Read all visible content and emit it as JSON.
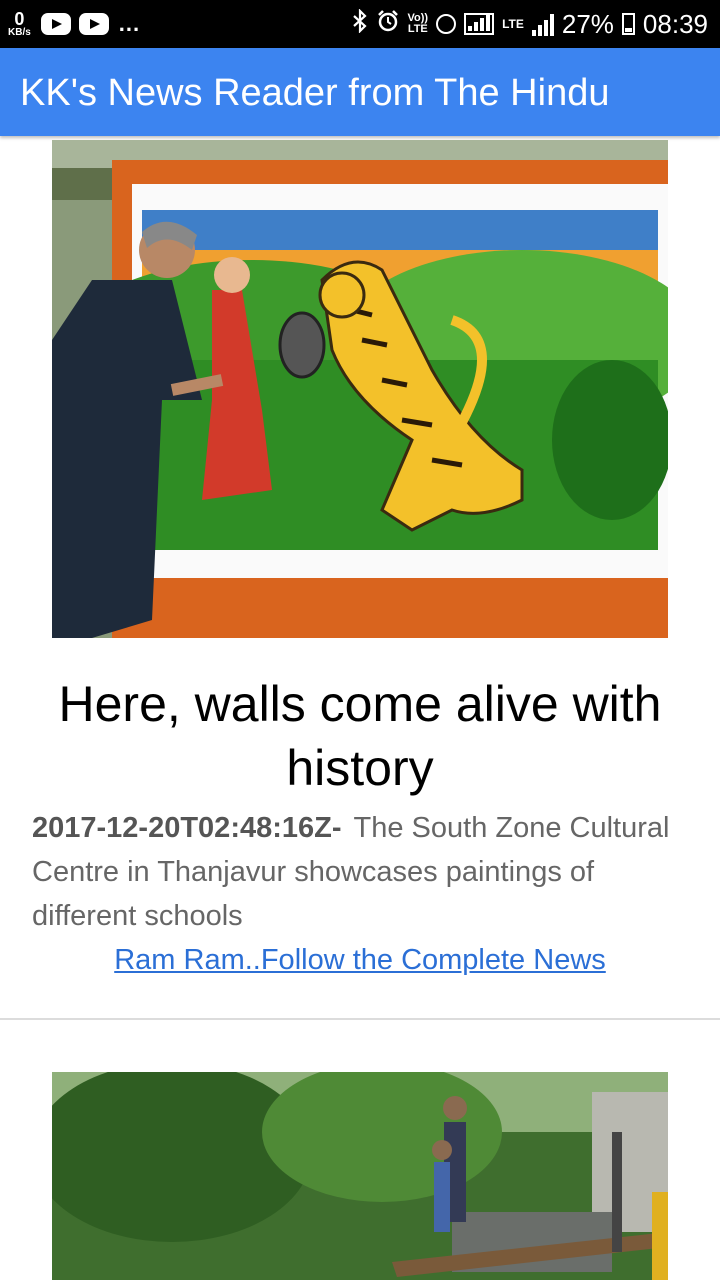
{
  "status_bar": {
    "net_speed_value": "0",
    "net_speed_unit": "KB/s",
    "more_indicator": "...",
    "volte_top": "Vo))",
    "volte_bottom": "LTE",
    "lte_badge": "LTE",
    "battery": "27%",
    "time": "08:39"
  },
  "app_bar": {
    "title": "KK's News Reader from The Hindu",
    "color": "#3c84f0"
  },
  "articles": [
    {
      "image": "mural-painting-photo",
      "headline": "Here, walls come alive with history",
      "timestamp": "2017-12-20T02:48:16Z-",
      "summary": "The South Zone Cultural Centre in Thanjavur showcases paintings of different schools",
      "link_label": "Ram Ram..Follow the Complete News"
    },
    {
      "image": "canal-crossing-photo"
    }
  ]
}
